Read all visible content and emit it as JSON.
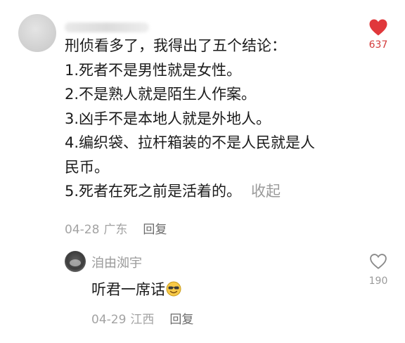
{
  "comment": {
    "lines": [
      "刑侦看多了，我得出了五个结论：",
      "1.死者不是男性就是女性。",
      "2.不是熟人就是陌生人作案。",
      "3.凶手不是本地人就是外地人。",
      "4.编织袋、拉杆箱装的不是人民就是人",
      "民币。",
      "5.死者在死之前是活着的。"
    ],
    "collapse_label": "收起",
    "date": "04-28",
    "location": "广东",
    "reply_label": "回复",
    "like_count": "637",
    "liked": true,
    "like_icon": "heart-filled-icon",
    "like_color": "#e0383b"
  },
  "reply": {
    "username": "洎由洳宇",
    "text": "听君一席话",
    "emoji": "smiling-face-with-sunglasses-emoji",
    "date": "04-29",
    "location": "江西",
    "reply_label": "回复",
    "like_count": "190",
    "liked": false,
    "like_icon": "heart-outline-icon"
  }
}
